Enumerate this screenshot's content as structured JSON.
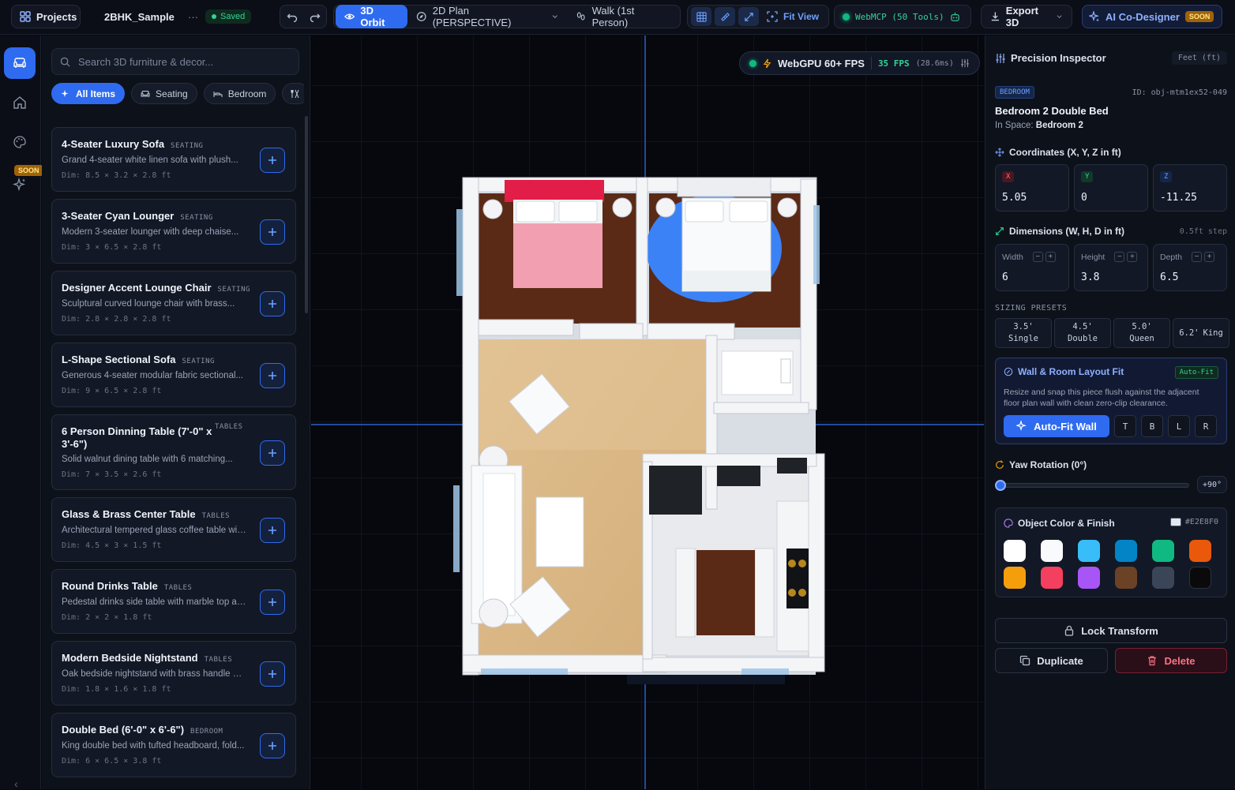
{
  "topbar": {
    "projects_label": "Projects",
    "project_name": "2BHK_Sample",
    "more_label": "···",
    "saved_label": "Saved",
    "view_modes": [
      {
        "label": "3D Orbit",
        "active": true
      },
      {
        "label": "2D Plan (PERSPECTIVE)",
        "active": false
      },
      {
        "label": "Walk (1st Person)",
        "active": false
      }
    ],
    "fit_view_label": "Fit View",
    "webmcp_label": "WebMCP (50 Tools)",
    "export_label": "Export 3D",
    "ai_label": "AI Co-Designer",
    "ai_badge": "SOON"
  },
  "rail": {
    "soon_badge": "SOON",
    "icons": [
      "sofa-icon",
      "home-icon",
      "palette-icon",
      "sparkles-icon"
    ]
  },
  "catalog": {
    "search_placeholder": "Search 3D furniture & decor...",
    "chips": [
      {
        "label": "All Items",
        "active": true
      },
      {
        "label": "Seating",
        "active": false
      },
      {
        "label": "Bedroom",
        "active": false
      }
    ],
    "items": [
      {
        "title": "4-Seater Luxury Sofa",
        "category": "SEATING",
        "desc": "Grand 4-seater white linen sofa with plush...",
        "dims": "Dim: 8.5 × 3.2 × 2.8 ft"
      },
      {
        "title": "3-Seater Cyan Lounger",
        "category": "SEATING",
        "desc": "Modern 3-seater lounger with deep chaise...",
        "dims": "Dim: 3 × 6.5 × 2.8 ft"
      },
      {
        "title": "Designer Accent Lounge Chair",
        "category": "SEATING",
        "desc": "Sculptural curved lounge chair with brass...",
        "dims": "Dim: 2.8 × 2.8 × 2.8 ft"
      },
      {
        "title": "L-Shape Sectional Sofa",
        "category": "SEATING",
        "desc": "Generous 4-seater modular fabric sectional...",
        "dims": "Dim: 9 × 6.5 × 2.8 ft"
      },
      {
        "title": "6 Person Dinning Table (7'-0\" x 3'-6\")",
        "category": "TABLES",
        "desc": "Solid walnut dining table with 6 matching...",
        "dims": "Dim: 7 × 3.5 × 2.6 ft"
      },
      {
        "title": "Glass & Brass Center Table",
        "category": "TABLES",
        "desc": "Architectural tempered glass coffee table wit...",
        "dims": "Dim: 4.5 × 3 × 1.5 ft"
      },
      {
        "title": "Round Drinks Table",
        "category": "TABLES",
        "desc": "Pedestal drinks side table with marble top an...",
        "dims": "Dim: 2 × 2 × 1.8 ft"
      },
      {
        "title": "Modern Bedside Nightstand",
        "category": "TABLES",
        "desc": "Oak bedside nightstand with brass handle an...",
        "dims": "Dim: 1.8 × 1.6 × 1.8 ft"
      },
      {
        "title": "Double Bed (6'-0\" x 6'-6\")",
        "category": "BEDROOM",
        "desc": "King double bed with tufted headboard, fold...",
        "dims": "Dim: 6 × 6.5 × 3.8 ft"
      }
    ]
  },
  "viewport": {
    "fps_label": "WebGPU 60+ FPS",
    "fps_value": "35 FPS",
    "frame_time": "(28.6ms)"
  },
  "inspector": {
    "title": "Precision Inspector",
    "units": "Feet (ft)",
    "room_tag": "BEDROOM",
    "object_id": "ID: obj-mtm1ex52-049",
    "object_name": "Bedroom 2 Double Bed",
    "space_label": "In Space:",
    "space_value": "Bedroom 2",
    "coords_label": "Coordinates (X, Y, Z in ft)",
    "coords": [
      {
        "axis": "X",
        "value": "5.05"
      },
      {
        "axis": "Y",
        "value": "0"
      },
      {
        "axis": "Z",
        "value": "-11.25"
      }
    ],
    "dims_label": "Dimensions (W, H, D in ft)",
    "step_label": "0.5ft step",
    "dims": [
      {
        "label": "Width",
        "value": "6"
      },
      {
        "label": "Height",
        "value": "3.8"
      },
      {
        "label": "Depth",
        "value": "6.5"
      }
    ],
    "presets_label": "SIZING PRESETS",
    "presets": [
      {
        "size": "3.5'",
        "name": "Single"
      },
      {
        "size": "4.5'",
        "name": "Double"
      },
      {
        "size": "5.0'",
        "name": "Queen"
      },
      {
        "size": "6.2'",
        "name": "King"
      }
    ],
    "fit_title": "Wall & Room Layout Fit",
    "fit_badge": "Auto-Fit",
    "fit_desc_1": "Resize and snap this piece flush against the adjacent",
    "fit_desc_2": "floor plan wall with clean zero-clip clearance.",
    "fit_button": "Auto-Fit Wall",
    "fit_sides": [
      "T",
      "B",
      "L",
      "R"
    ],
    "yaw_label": "Yaw Rotation (0°)",
    "yaw_value": 0,
    "yaw_step": "+90°",
    "color_label": "Object Color & Finish",
    "color_hex": "#E2E8F0",
    "swatches": [
      "#ffffff",
      "#f8fafc",
      "#38bdf8",
      "#0284c7",
      "#10b981",
      "#ea580c",
      "#f59e0b",
      "#f43f5e",
      "#a855f7",
      "#6b4226",
      "#3a4558",
      "#0a0a0a"
    ],
    "lock_label": "Lock Transform",
    "duplicate_label": "Duplicate",
    "delete_label": "Delete"
  },
  "colors": {
    "accent": "#2f6bf0",
    "success": "#34d399",
    "danger": "#f43f5e"
  }
}
